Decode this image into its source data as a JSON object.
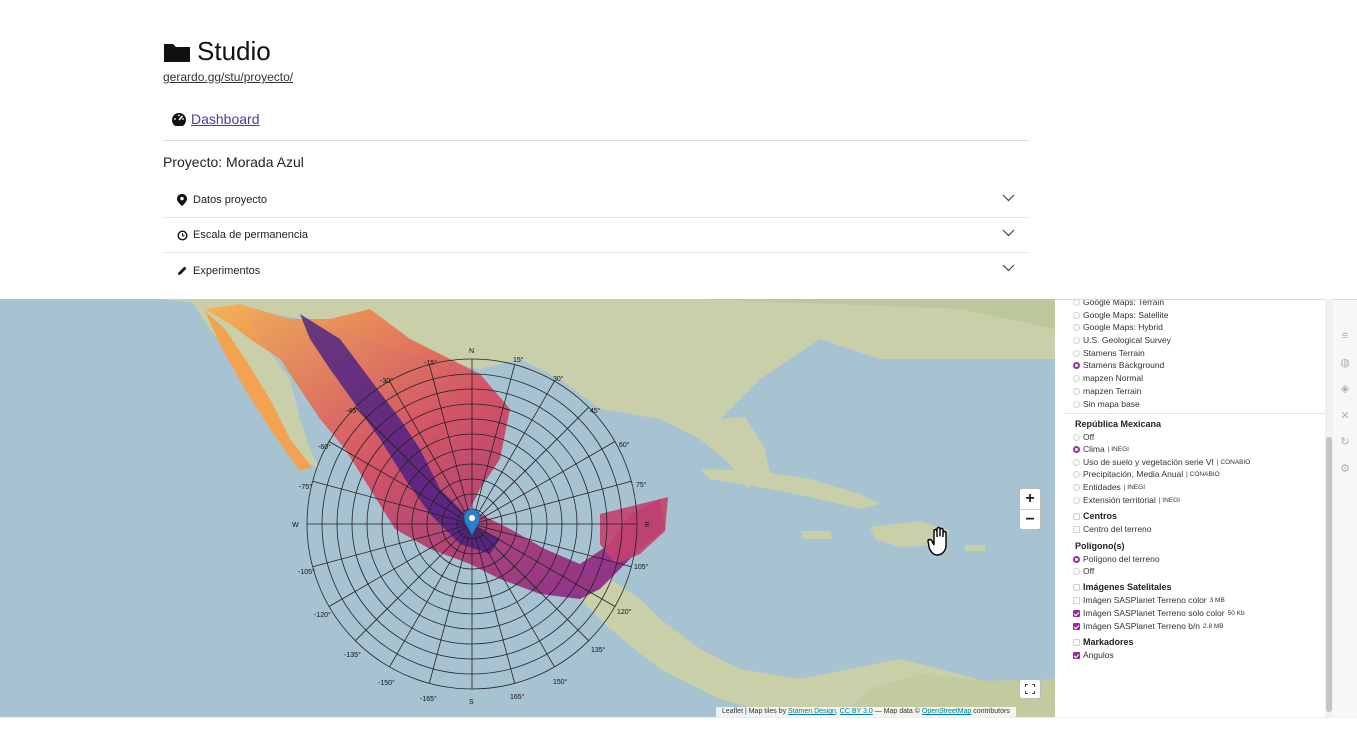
{
  "header": {
    "title": "Studio",
    "url": "gerardo.gg/stu/proyecto/",
    "dashboard_label": "Dashboard",
    "project_title": "Proyecto: Morada Azul"
  },
  "accordion": [
    {
      "label": "Datos proyecto",
      "icon": "map-marker-icon"
    },
    {
      "label": "Escala de permanencia",
      "icon": "clock-icon"
    },
    {
      "label": "Experimentos",
      "icon": "pencil-icon"
    }
  ],
  "base_maps": [
    {
      "label": "Google Maps: Terrain",
      "selected": false
    },
    {
      "label": "Google Maps: Satellite",
      "selected": false
    },
    {
      "label": "Google Maps: Hybrid",
      "selected": false
    },
    {
      "label": "U.S. Geological Survey",
      "selected": false
    },
    {
      "label": "Stamens Terrain",
      "selected": false
    },
    {
      "label": "Stamens Background",
      "selected": true
    },
    {
      "label": "mapzen Normal",
      "selected": false
    },
    {
      "label": "mapzen Terrain",
      "selected": false
    },
    {
      "label": "Sin mapa base",
      "selected": false
    }
  ],
  "republica": {
    "title": "República Mexicana",
    "options": [
      {
        "label": "Off",
        "source": "",
        "selected": false
      },
      {
        "label": "Clima",
        "source": "| INEGI",
        "selected": true
      },
      {
        "label": "Uso de suelo y vegetación serie VI",
        "source": "| CONABIO",
        "selected": false
      },
      {
        "label": "Precipitación, Media Anual",
        "source": "| CONABIO",
        "selected": false
      },
      {
        "label": "Entidades",
        "source": "| INEGI",
        "selected": false
      },
      {
        "label": "Extensión territorial",
        "source": "| INEGI",
        "selected": false
      }
    ]
  },
  "centros": {
    "title": "Centros",
    "options": [
      {
        "label": "Centro del terreno",
        "checked": false
      }
    ]
  },
  "poligonos": {
    "title": "Polígono(s)",
    "options": [
      {
        "label": "Polígono del terreno",
        "selected": true
      },
      {
        "label": "Off",
        "selected": false
      }
    ]
  },
  "imagenes": {
    "title": "Imágenes Satelitales",
    "options": [
      {
        "label": "Imágen SASPlanet Terreno color",
        "size": "3 MB",
        "checked": false
      },
      {
        "label": "Imágen SASPlanet Terreno solo color",
        "size": "50 Kb",
        "checked": true
      },
      {
        "label": "Imágen SASPlanet Terreno b/n",
        "size": "2.8 MB",
        "checked": true
      }
    ]
  },
  "markadores": {
    "title": "Markadores",
    "options": [
      {
        "label": "Ángulos",
        "checked": true
      }
    ]
  },
  "map": {
    "zoom_in": "+",
    "zoom_out": "−",
    "compass": {
      "n": "N",
      "s": "S",
      "w": "W",
      "e": "E"
    },
    "angles": [
      "15°",
      "30°",
      "45°",
      "60°",
      "75°",
      "105°",
      "120°",
      "135°",
      "150°",
      "165°",
      "-15°",
      "-30°",
      "-45°",
      "-60°",
      "-75°",
      "-105°",
      "-120°",
      "-135°",
      "-150°",
      "-165°"
    ],
    "attribution": {
      "prefix": "Leaflet | Map tiles by",
      "stamen": "Stamen Design",
      "cc": "CC BY 3.0",
      "middle": "— Map data ©",
      "osm": "OpenStreetMap",
      "suffix": "contributors"
    }
  },
  "colors": {
    "accent": "#9c2aa0",
    "link": "#4a3aa8",
    "water": "#a7c3d2",
    "land": "#c9cfa9"
  }
}
